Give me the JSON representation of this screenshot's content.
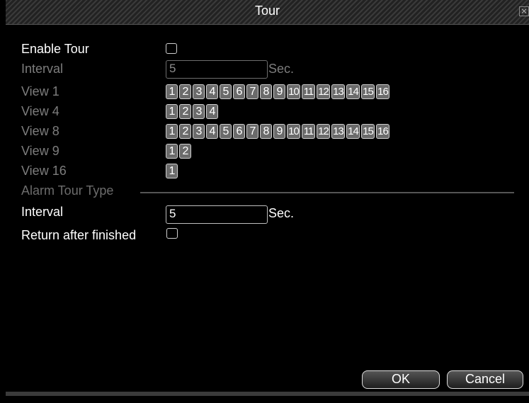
{
  "dialog": {
    "title": "Tour",
    "close_glyph": "✕"
  },
  "enable_tour": {
    "label": "Enable Tour",
    "checked": false
  },
  "interval_top": {
    "label": "Interval",
    "value": "5",
    "unit": "Sec."
  },
  "views": [
    {
      "label": "View 1",
      "channels": [
        "1",
        "2",
        "3",
        "4",
        "5",
        "6",
        "7",
        "8",
        "9",
        "10",
        "11",
        "12",
        "13",
        "14",
        "15",
        "16"
      ]
    },
    {
      "label": "View 4",
      "channels": [
        "1",
        "2",
        "3",
        "4"
      ]
    },
    {
      "label": "View 8",
      "channels": [
        "1",
        "2",
        "3",
        "4",
        "5",
        "6",
        "7",
        "8",
        "9",
        "10",
        "11",
        "12",
        "13",
        "14",
        "15",
        "16"
      ]
    },
    {
      "label": "View 9",
      "channels": [
        "1",
        "2"
      ]
    },
    {
      "label": "View 16",
      "channels": [
        "1"
      ]
    }
  ],
  "alarm_section": {
    "label": "Alarm Tour Type"
  },
  "interval_alarm": {
    "label": "Interval",
    "value": "5",
    "unit": "Sec."
  },
  "return_after_finished": {
    "label": "Return after finished",
    "checked": false
  },
  "buttons": {
    "ok": "OK",
    "cancel": "Cancel"
  }
}
